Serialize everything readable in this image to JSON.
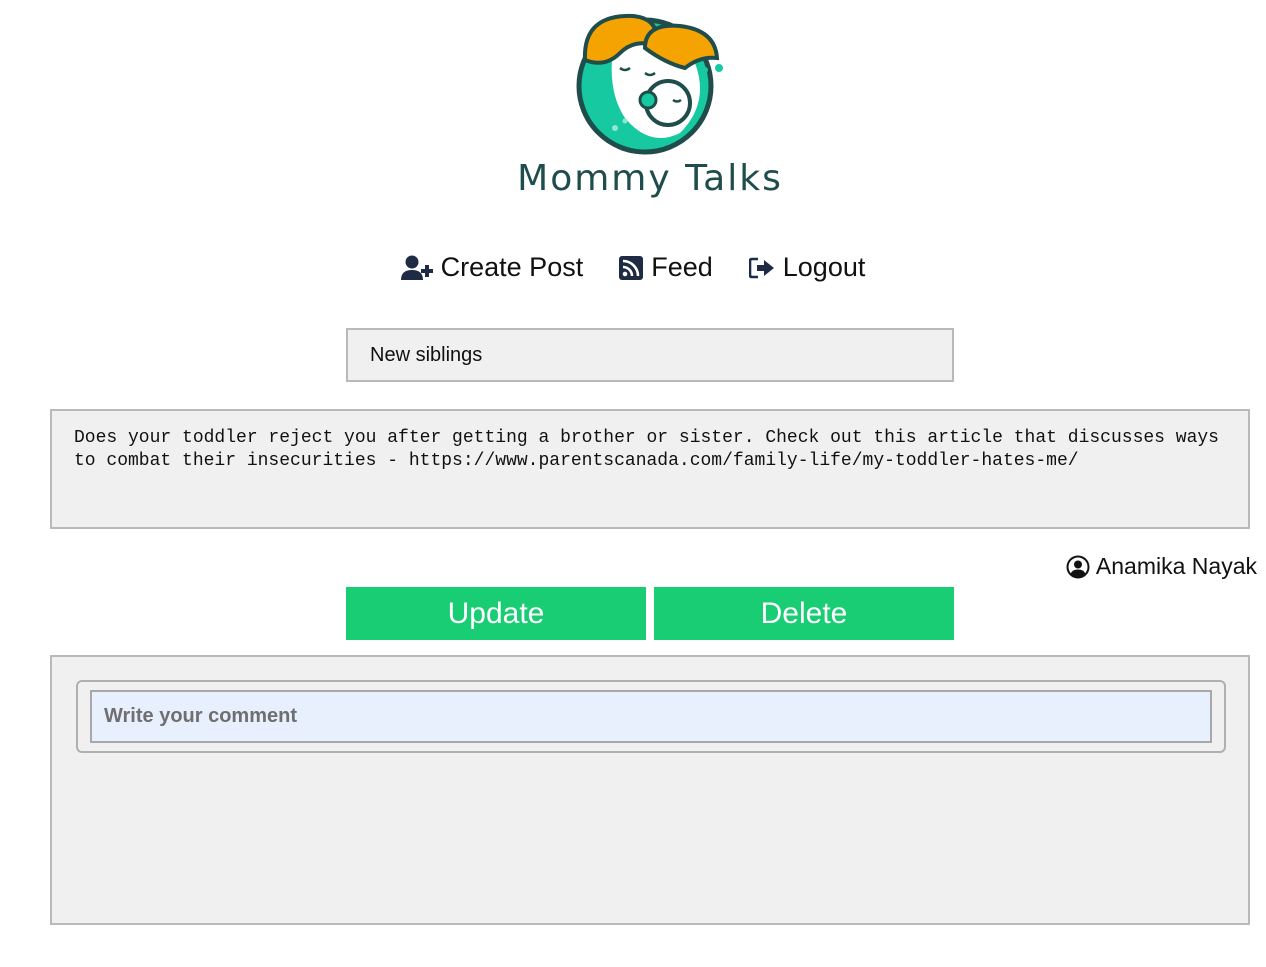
{
  "brand": {
    "name": "Mommy Talks",
    "colors": {
      "hair": "#f5a300",
      "teal": "#17c9a0",
      "dark": "#1f4d4b"
    }
  },
  "nav": {
    "items": [
      {
        "label": "Create Post",
        "icon": "user-plus-icon"
      },
      {
        "label": "Feed",
        "icon": "rss-icon"
      },
      {
        "label": "Logout",
        "icon": "sign-out-icon"
      }
    ]
  },
  "post": {
    "title_value": "New siblings",
    "body_value": "Does your toddler reject you after getting a brother or sister. Check out this article that discusses ways to combat their insecurities - https://www.parentscanada.com/family-life/my-toddler-hates-me/",
    "author": "Anamika Nayak"
  },
  "actions": {
    "update_label": "Update",
    "delete_label": "Delete",
    "button_color": "#18cd73"
  },
  "comments": {
    "placeholder": "Write your comment"
  }
}
